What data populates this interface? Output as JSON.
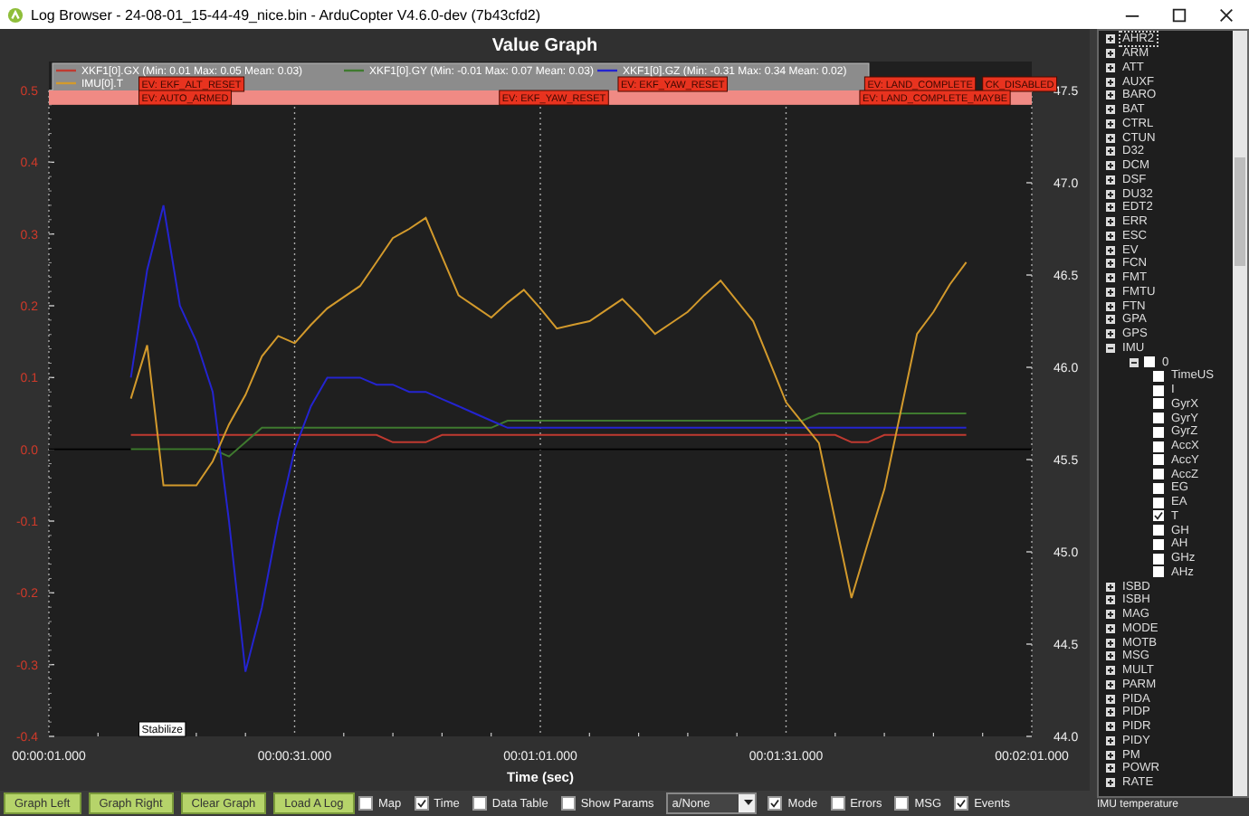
{
  "window": {
    "title": "Log Browser - 24-08-01_15-44-49_nice.bin - ArduCopter V4.6.0-dev (7b43cfd2)"
  },
  "graph": {
    "chart_data": {
      "type": "line",
      "title": "Value Graph",
      "xlabel": "Time (sec)",
      "categories": [
        "00:00:01.000",
        null,
        null,
        null,
        null,
        null,
        null,
        null,
        null,
        null,
        null,
        null,
        null,
        null,
        null,
        "00:00:31.000",
        null,
        null,
        null,
        null,
        null,
        null,
        null,
        null,
        null,
        null,
        null,
        null,
        null,
        null,
        "00:01:01.000",
        null,
        null,
        null,
        null,
        null,
        null,
        null,
        null,
        null,
        null,
        null,
        null,
        null,
        null,
        "00:01:31.000",
        null,
        null,
        null,
        null,
        null,
        null,
        null,
        null,
        null,
        null,
        null,
        null,
        null,
        null,
        "00:02:01.000"
      ],
      "ylim": [
        -0.4,
        0.5
      ],
      "y2lim": [
        44.0,
        47.5
      ],
      "grid": true,
      "legend": "top",
      "bands": [
        {
          "axis": "y",
          "from": 0.48,
          "to": 0.5,
          "color": "#f08a84"
        }
      ],
      "yticks": [
        {
          "value": 0.5,
          "label": "0.5"
        },
        {
          "value": 0.4,
          "label": "0.4"
        },
        {
          "value": 0.3,
          "label": "0.3"
        },
        {
          "value": 0.2,
          "label": "0.2"
        },
        {
          "value": 0.1,
          "label": "0.1"
        },
        {
          "value": 0,
          "label": "0.0"
        },
        {
          "value": -0.1,
          "label": "-0.1"
        },
        {
          "value": -0.2,
          "label": "-0.2"
        },
        {
          "value": -0.3,
          "label": "-0.3"
        },
        {
          "value": -0.4,
          "label": "-0.4"
        }
      ],
      "y2ticks": [
        {
          "value": 47.5,
          "label": "47.5"
        },
        {
          "value": 47,
          "label": "47.0"
        },
        {
          "value": 46.5,
          "label": "46.5"
        },
        {
          "value": 46,
          "label": "46.0"
        },
        {
          "value": 45.5,
          "label": "45.5"
        },
        {
          "value": 45,
          "label": "45.0"
        },
        {
          "value": 44.5,
          "label": "44.5"
        },
        {
          "value": 44,
          "label": "44.0"
        }
      ],
      "series": [
        {
          "name": "XKF1[0].GX  (Min: 0.01 Max: 0.05 Mean: 0.03)",
          "color": "#c03a30",
          "values": [
            null,
            null,
            null,
            null,
            null,
            0.02,
            0.02,
            0.02,
            0.02,
            0.02,
            0.02,
            0.02,
            0.02,
            0.02,
            0.02,
            0.02,
            0.02,
            0.02,
            0.02,
            0.02,
            0.02,
            0.01,
            0.01,
            0.01,
            0.02,
            0.02,
            0.02,
            0.02,
            0.02,
            0.02,
            0.02,
            0.02,
            0.02,
            0.02,
            0.02,
            0.02,
            0.02,
            0.02,
            0.02,
            0.02,
            0.02,
            0.02,
            0.02,
            0.02,
            0.02,
            0.02,
            0.02,
            0.02,
            0.02,
            0.01,
            0.01,
            0.02,
            0.02,
            0.02,
            0.02,
            0.02,
            0.02,
            null,
            null,
            null,
            null
          ]
        },
        {
          "name": "XKF1[0].GY  (Min: -0.01 Max: 0.07 Mean: 0.03)",
          "color": "#3f7a2f",
          "values": [
            null,
            null,
            null,
            null,
            null,
            0,
            0,
            0,
            0,
            0,
            0,
            -0.01,
            0.01,
            0.03,
            0.03,
            0.03,
            0.03,
            0.03,
            0.03,
            0.03,
            0.03,
            0.03,
            0.03,
            0.03,
            0.03,
            0.03,
            0.03,
            0.03,
            0.04,
            0.04,
            0.04,
            0.04,
            0.04,
            0.04,
            0.04,
            0.04,
            0.04,
            0.04,
            0.04,
            0.04,
            0.04,
            0.04,
            0.04,
            0.04,
            0.04,
            0.04,
            0.04,
            0.05,
            0.05,
            0.05,
            0.05,
            0.05,
            0.05,
            0.05,
            0.05,
            0.05,
            0.05,
            null,
            null,
            null,
            null
          ]
        },
        {
          "name": "XKF1[0].GZ  (Min: -0.31 Max: 0.34 Mean: 0.02)",
          "color": "#2424d0",
          "values": [
            null,
            null,
            null,
            null,
            null,
            0.1,
            0.25,
            0.34,
            0.2,
            0.15,
            0.08,
            -0.1,
            -0.31,
            -0.22,
            -0.1,
            0,
            0.06,
            0.1,
            0.1,
            0.1,
            0.09,
            0.09,
            0.08,
            0.08,
            0.07,
            0.06,
            0.05,
            0.04,
            0.03,
            0.03,
            0.03,
            0.03,
            0.03,
            0.03,
            0.03,
            0.03,
            0.03,
            0.03,
            0.03,
            0.03,
            0.03,
            0.03,
            0.03,
            0.03,
            0.03,
            0.03,
            0.03,
            0.03,
            0.03,
            0.03,
            0.03,
            0.03,
            0.03,
            0.03,
            0.03,
            0.03,
            0.03,
            null,
            null,
            null,
            null
          ]
        },
        {
          "name": "IMU[0].T",
          "color": "#d39a2c",
          "axis": "y2",
          "values": [
            null,
            null,
            null,
            null,
            null,
            45.83,
            46.12,
            45.36,
            45.36,
            45.36,
            45.49,
            45.69,
            45.85,
            46.06,
            46.17,
            46.13,
            46.23,
            46.32,
            46.38,
            46.44,
            46.57,
            46.7,
            46.75,
            46.81,
            46.6,
            46.39,
            46.33,
            46.27,
            46.35,
            46.42,
            46.32,
            46.21,
            46.23,
            46.25,
            46.31,
            46.37,
            46.28,
            46.18,
            46.24,
            46.3,
            46.39,
            46.47,
            46.36,
            46.25,
            46.03,
            45.81,
            45.7,
            45.59,
            45.17,
            44.75,
            45.05,
            45.34,
            45.76,
            46.18,
            46.3,
            46.45,
            46.57,
            null,
            null,
            null,
            null
          ]
        }
      ]
    },
    "events": [
      {
        "kind": "upper",
        "label": "EV: EKF_ALT_RESET"
      },
      {
        "kind": "upper",
        "label": "EV: EKF_YAW_RESET"
      },
      {
        "kind": "upper",
        "label": "EV: LAND_COMPLETE"
      },
      {
        "kind": "upper",
        "label": "CK_DISABLED"
      },
      {
        "kind": "lower",
        "label": "EV: AUTO_ARMED"
      },
      {
        "kind": "lower",
        "label": "EV: EKF_YAW_RESET"
      },
      {
        "kind": "lower",
        "label": "EV: LAND_COMPLETE_MAYBE"
      }
    ],
    "mode_label": "Stabilize"
  },
  "tree": {
    "items": [
      {
        "label": "AHR2",
        "expanded": false,
        "selected": true
      },
      {
        "label": "ARM",
        "expanded": false,
        "selected": false
      },
      {
        "label": "ATT",
        "expanded": false,
        "selected": false
      },
      {
        "label": "AUXF",
        "expanded": false,
        "selected": false
      },
      {
        "label": "BARO",
        "expanded": false,
        "selected": false
      },
      {
        "label": "BAT",
        "expanded": false,
        "selected": false
      },
      {
        "label": "CTRL",
        "expanded": false,
        "selected": false
      },
      {
        "label": "CTUN",
        "expanded": false,
        "selected": false
      },
      {
        "label": "D32",
        "expanded": false,
        "selected": false
      },
      {
        "label": "DCM",
        "expanded": false,
        "selected": false
      },
      {
        "label": "DSF",
        "expanded": false,
        "selected": false
      },
      {
        "label": "DU32",
        "expanded": false,
        "selected": false
      },
      {
        "label": "EDT2",
        "expanded": false,
        "selected": false
      },
      {
        "label": "ERR",
        "expanded": false,
        "selected": false
      },
      {
        "label": "ESC",
        "expanded": false,
        "selected": false
      },
      {
        "label": "EV",
        "expanded": false,
        "selected": false
      },
      {
        "label": "FCN",
        "expanded": false,
        "selected": false
      },
      {
        "label": "FMT",
        "expanded": false,
        "selected": false
      },
      {
        "label": "FMTU",
        "expanded": false,
        "selected": false
      },
      {
        "label": "FTN",
        "expanded": false,
        "selected": false
      },
      {
        "label": "GPA",
        "expanded": false,
        "selected": false
      },
      {
        "label": "GPS",
        "expanded": false,
        "selected": false
      },
      {
        "label": "IMU",
        "expanded": true,
        "selected": false,
        "children": [
          {
            "label": "0",
            "expanded": true,
            "checked": false,
            "children": [
              {
                "label": "TimeUS",
                "checked": false
              },
              {
                "label": "I",
                "checked": false
              },
              {
                "label": "GyrX",
                "checked": false
              },
              {
                "label": "GyrY",
                "checked": false
              },
              {
                "label": "GyrZ",
                "checked": false
              },
              {
                "label": "AccX",
                "checked": false
              },
              {
                "label": "AccY",
                "checked": false
              },
              {
                "label": "AccZ",
                "checked": false
              },
              {
                "label": "EG",
                "checked": false
              },
              {
                "label": "EA",
                "checked": false
              },
              {
                "label": "T",
                "checked": true
              },
              {
                "label": "GH",
                "checked": false
              },
              {
                "label": "AH",
                "checked": false
              },
              {
                "label": "GHz",
                "checked": false
              },
              {
                "label": "AHz",
                "checked": false
              }
            ]
          }
        ]
      },
      {
        "label": "ISBD",
        "expanded": false,
        "selected": false
      },
      {
        "label": "ISBH",
        "expanded": false,
        "selected": false
      },
      {
        "label": "MAG",
        "expanded": false,
        "selected": false
      },
      {
        "label": "MODE",
        "expanded": false,
        "selected": false
      },
      {
        "label": "MOTB",
        "expanded": false,
        "selected": false
      },
      {
        "label": "MSG",
        "expanded": false,
        "selected": false
      },
      {
        "label": "MULT",
        "expanded": false,
        "selected": false
      },
      {
        "label": "PARM",
        "expanded": false,
        "selected": false
      },
      {
        "label": "PIDA",
        "expanded": false,
        "selected": false
      },
      {
        "label": "PIDP",
        "expanded": false,
        "selected": false
      },
      {
        "label": "PIDR",
        "expanded": false,
        "selected": false
      },
      {
        "label": "PIDY",
        "expanded": false,
        "selected": false
      },
      {
        "label": "PM",
        "expanded": false,
        "selected": false
      },
      {
        "label": "POWR",
        "expanded": false,
        "selected": false
      },
      {
        "label": "RATE",
        "expanded": false,
        "selected": false
      }
    ],
    "status": "IMU temperature"
  },
  "toolbar": {
    "buttons": [
      "Graph Left",
      "Graph Right",
      "Clear Graph",
      "Load A Log"
    ],
    "options": [
      {
        "kind": "checkbox",
        "label": "Map",
        "checked": false
      },
      {
        "kind": "checkbox",
        "label": "Time",
        "checked": true
      },
      {
        "kind": "checkbox",
        "label": "Data Table",
        "checked": false
      },
      {
        "kind": "checkbox",
        "label": "Show Params",
        "checked": false
      },
      {
        "kind": "dropdown",
        "value": "a/None"
      },
      {
        "kind": "checkbox",
        "label": "Mode",
        "checked": true
      },
      {
        "kind": "checkbox",
        "label": "Errors",
        "checked": false
      },
      {
        "kind": "checkbox",
        "label": "MSG",
        "checked": false
      },
      {
        "kind": "checkbox",
        "label": "Events",
        "checked": true
      }
    ]
  }
}
